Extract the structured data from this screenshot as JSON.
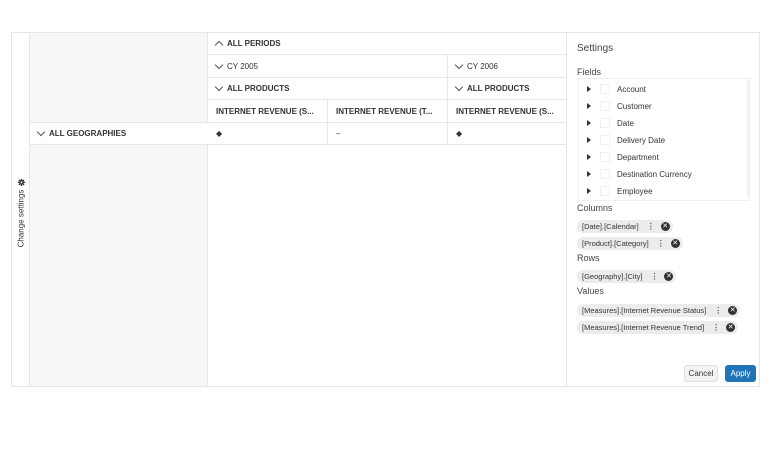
{
  "strip": {
    "label": "Change settings"
  },
  "columns_header": {
    "periods": "ALL PERIODS",
    "years": [
      "CY 2005",
      "CY 2006"
    ],
    "products": [
      "ALL PRODUCTS",
      "ALL PRODUCTS"
    ],
    "measures": [
      "INTERNET REVENUE (S...",
      "INTERNET REVENUE (T...",
      "INTERNET REVENUE (S..."
    ]
  },
  "rows": [
    {
      "label": "ALL GEOGRAPHIES",
      "values": [
        "◆",
        "–",
        "◆"
      ]
    }
  ],
  "settings": {
    "title": "Settings",
    "fields_label": "Fields",
    "fields": [
      "Account",
      "Customer",
      "Date",
      "Delivery Date",
      "Department",
      "Destination Currency",
      "Employee"
    ],
    "columns_label": "Columns",
    "columns": [
      "[Date].[Calendar]",
      "[Product].[Category]"
    ],
    "rows_label": "Rows",
    "rows": [
      "[Geography].[City]"
    ],
    "values_label": "Values",
    "values": [
      "[Measures].[Internet Revenue Status]",
      "[Measures].[Internet Revenue Trend]"
    ],
    "cancel": "Cancel",
    "apply": "Apply"
  }
}
